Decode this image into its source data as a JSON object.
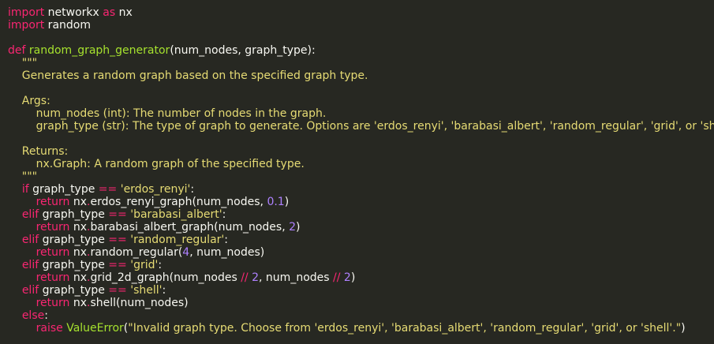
{
  "code": {
    "language": "python",
    "theme_colors": {
      "background": "#272822",
      "text": "#f8f8f2",
      "keyword": "#f92672",
      "function": "#a6e22e",
      "string": "#e6db74",
      "number": "#ae81ff"
    },
    "lines": [
      [
        {
          "t": "import",
          "c": "kw"
        },
        {
          "t": " networkx ",
          "c": "plain"
        },
        {
          "t": "as",
          "c": "kw"
        },
        {
          "t": " nx",
          "c": "plain"
        }
      ],
      [
        {
          "t": "import",
          "c": "kw"
        },
        {
          "t": " random",
          "c": "plain"
        }
      ],
      [],
      [
        {
          "t": "def",
          "c": "kw"
        },
        {
          "t": " ",
          "c": "plain"
        },
        {
          "t": "random_graph_generator",
          "c": "fn"
        },
        {
          "t": "(num_nodes, graph_type):",
          "c": "plain"
        }
      ],
      [
        {
          "t": "    \"\"\"",
          "c": "str"
        }
      ],
      [
        {
          "t": "    Generates a random graph based on the specified graph type.",
          "c": "str"
        }
      ],
      [],
      [
        {
          "t": "    Args:",
          "c": "str"
        }
      ],
      [
        {
          "t": "        num_nodes (int): The number of nodes in the graph.",
          "c": "str"
        }
      ],
      [
        {
          "t": "        graph_type (str): The type of graph to generate. Options are 'erdos_renyi', 'barabasi_albert', 'random_regular', 'grid', or 'shell'.",
          "c": "str"
        }
      ],
      [],
      [
        {
          "t": "    Returns:",
          "c": "str"
        }
      ],
      [
        {
          "t": "        nx.Graph: A random graph of the specified type.",
          "c": "str"
        }
      ],
      [
        {
          "t": "    \"\"\"",
          "c": "str"
        }
      ],
      [
        {
          "t": "    ",
          "c": "plain"
        },
        {
          "t": "if",
          "c": "kw"
        },
        {
          "t": " graph_type ",
          "c": "plain"
        },
        {
          "t": "==",
          "c": "kw"
        },
        {
          "t": " ",
          "c": "plain"
        },
        {
          "t": "'erdos_renyi'",
          "c": "str"
        },
        {
          "t": ":",
          "c": "plain"
        }
      ],
      [
        {
          "t": "        ",
          "c": "plain"
        },
        {
          "t": "return",
          "c": "kw"
        },
        {
          "t": " nx",
          "c": "plain"
        },
        {
          "t": ".",
          "c": "kw"
        },
        {
          "t": "erdos_renyi_graph(num_nodes, ",
          "c": "plain"
        },
        {
          "t": "0.1",
          "c": "num"
        },
        {
          "t": ")",
          "c": "plain"
        }
      ],
      [
        {
          "t": "    ",
          "c": "plain"
        },
        {
          "t": "elif",
          "c": "kw"
        },
        {
          "t": " graph_type ",
          "c": "plain"
        },
        {
          "t": "==",
          "c": "kw"
        },
        {
          "t": " ",
          "c": "plain"
        },
        {
          "t": "'barabasi_albert'",
          "c": "str"
        },
        {
          "t": ":",
          "c": "plain"
        }
      ],
      [
        {
          "t": "        ",
          "c": "plain"
        },
        {
          "t": "return",
          "c": "kw"
        },
        {
          "t": " nx",
          "c": "plain"
        },
        {
          "t": ".",
          "c": "kw"
        },
        {
          "t": "barabasi_albert_graph(num_nodes, ",
          "c": "plain"
        },
        {
          "t": "2",
          "c": "num"
        },
        {
          "t": ")",
          "c": "plain"
        }
      ],
      [
        {
          "t": "    ",
          "c": "plain"
        },
        {
          "t": "elif",
          "c": "kw"
        },
        {
          "t": " graph_type ",
          "c": "plain"
        },
        {
          "t": "==",
          "c": "kw"
        },
        {
          "t": " ",
          "c": "plain"
        },
        {
          "t": "'random_regular'",
          "c": "str"
        },
        {
          "t": ":",
          "c": "plain"
        }
      ],
      [
        {
          "t": "        ",
          "c": "plain"
        },
        {
          "t": "return",
          "c": "kw"
        },
        {
          "t": " nx",
          "c": "plain"
        },
        {
          "t": ".",
          "c": "kw"
        },
        {
          "t": "random_regular(",
          "c": "plain"
        },
        {
          "t": "4",
          "c": "num"
        },
        {
          "t": ", num_nodes)",
          "c": "plain"
        }
      ],
      [
        {
          "t": "    ",
          "c": "plain"
        },
        {
          "t": "elif",
          "c": "kw"
        },
        {
          "t": " graph_type ",
          "c": "plain"
        },
        {
          "t": "==",
          "c": "kw"
        },
        {
          "t": " ",
          "c": "plain"
        },
        {
          "t": "'grid'",
          "c": "str"
        },
        {
          "t": ":",
          "c": "plain"
        }
      ],
      [
        {
          "t": "        ",
          "c": "plain"
        },
        {
          "t": "return",
          "c": "kw"
        },
        {
          "t": " nx",
          "c": "plain"
        },
        {
          "t": ".",
          "c": "kw"
        },
        {
          "t": "grid_2d_graph(num_nodes ",
          "c": "plain"
        },
        {
          "t": "//",
          "c": "kw"
        },
        {
          "t": " ",
          "c": "plain"
        },
        {
          "t": "2",
          "c": "num"
        },
        {
          "t": ", num_nodes ",
          "c": "plain"
        },
        {
          "t": "//",
          "c": "kw"
        },
        {
          "t": " ",
          "c": "plain"
        },
        {
          "t": "2",
          "c": "num"
        },
        {
          "t": ")",
          "c": "plain"
        }
      ],
      [
        {
          "t": "    ",
          "c": "plain"
        },
        {
          "t": "elif",
          "c": "kw"
        },
        {
          "t": " graph_type ",
          "c": "plain"
        },
        {
          "t": "==",
          "c": "kw"
        },
        {
          "t": " ",
          "c": "plain"
        },
        {
          "t": "'shell'",
          "c": "str"
        },
        {
          "t": ":",
          "c": "plain"
        }
      ],
      [
        {
          "t": "        ",
          "c": "plain"
        },
        {
          "t": "return",
          "c": "kw"
        },
        {
          "t": " nx",
          "c": "plain"
        },
        {
          "t": ".",
          "c": "kw"
        },
        {
          "t": "shell(num_nodes)",
          "c": "plain"
        }
      ],
      [
        {
          "t": "    ",
          "c": "plain"
        },
        {
          "t": "else",
          "c": "kw"
        },
        {
          "t": ":",
          "c": "plain"
        }
      ],
      [
        {
          "t": "        ",
          "c": "plain"
        },
        {
          "t": "raise",
          "c": "kw"
        },
        {
          "t": " ",
          "c": "plain"
        },
        {
          "t": "ValueError",
          "c": "fn"
        },
        {
          "t": "(",
          "c": "plain"
        },
        {
          "t": "\"Invalid graph type. Choose from 'erdos_renyi', 'barabasi_albert', 'random_regular', 'grid', or 'shell'.\"",
          "c": "str"
        },
        {
          "t": ")",
          "c": "plain"
        }
      ]
    ]
  }
}
